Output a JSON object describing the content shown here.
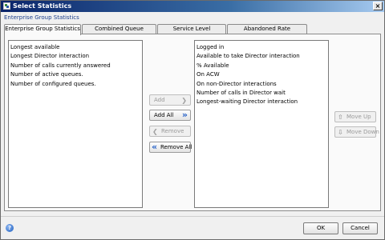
{
  "window": {
    "title": "Select Statistics",
    "close_glyph": "×"
  },
  "subtitle": "Enterprise Group Statistics",
  "tabs": [
    {
      "label": "Enterprise Group Statistics",
      "active": true
    },
    {
      "label": "Combined Queue Statistics",
      "active": false
    },
    {
      "label": "Service Level Parameters",
      "active": false
    },
    {
      "label": "Abandoned Rate Parameters",
      "active": false
    }
  ],
  "available_list": {
    "items": [
      "Longest available",
      "Longest Director interaction",
      "Number of calls currently answered",
      "Number of active queues.",
      "Number of configured queues."
    ]
  },
  "selected_list": {
    "items": [
      "Logged in",
      "Available to take Director interaction",
      "% Available",
      "On ACW",
      "On non-Director interactions",
      "Number of calls in Director wait",
      "Longest-waiting Director interaction"
    ]
  },
  "transfer_buttons": {
    "add": {
      "label": "Add",
      "icon": "chevron-right-icon",
      "glyph": "❯",
      "enabled": false
    },
    "add_all": {
      "label": "Add All",
      "icon": "double-chevron-right-icon",
      "glyph": "»",
      "enabled": true
    },
    "remove": {
      "label": "Remove",
      "icon": "chevron-left-icon",
      "glyph": "❮",
      "enabled": false
    },
    "remove_all": {
      "label": "Remove All",
      "icon": "double-chevron-left-icon",
      "glyph": "«",
      "enabled": true
    }
  },
  "order_buttons": {
    "move_up": {
      "label": "Move Up",
      "icon": "move-up-icon",
      "glyph": "⇧",
      "enabled": false
    },
    "move_down": {
      "label": "Move Down",
      "icon": "move-down-icon",
      "glyph": "⇩",
      "enabled": false
    }
  },
  "footer": {
    "ok_label": "OK",
    "cancel_label": "Cancel",
    "help_glyph": "?"
  },
  "colors": {
    "titlebar_start": "#0a246a",
    "titlebar_end": "#a6caf0",
    "accent_blue": "#2a64c8",
    "subtitle": "#1a3d8a"
  }
}
